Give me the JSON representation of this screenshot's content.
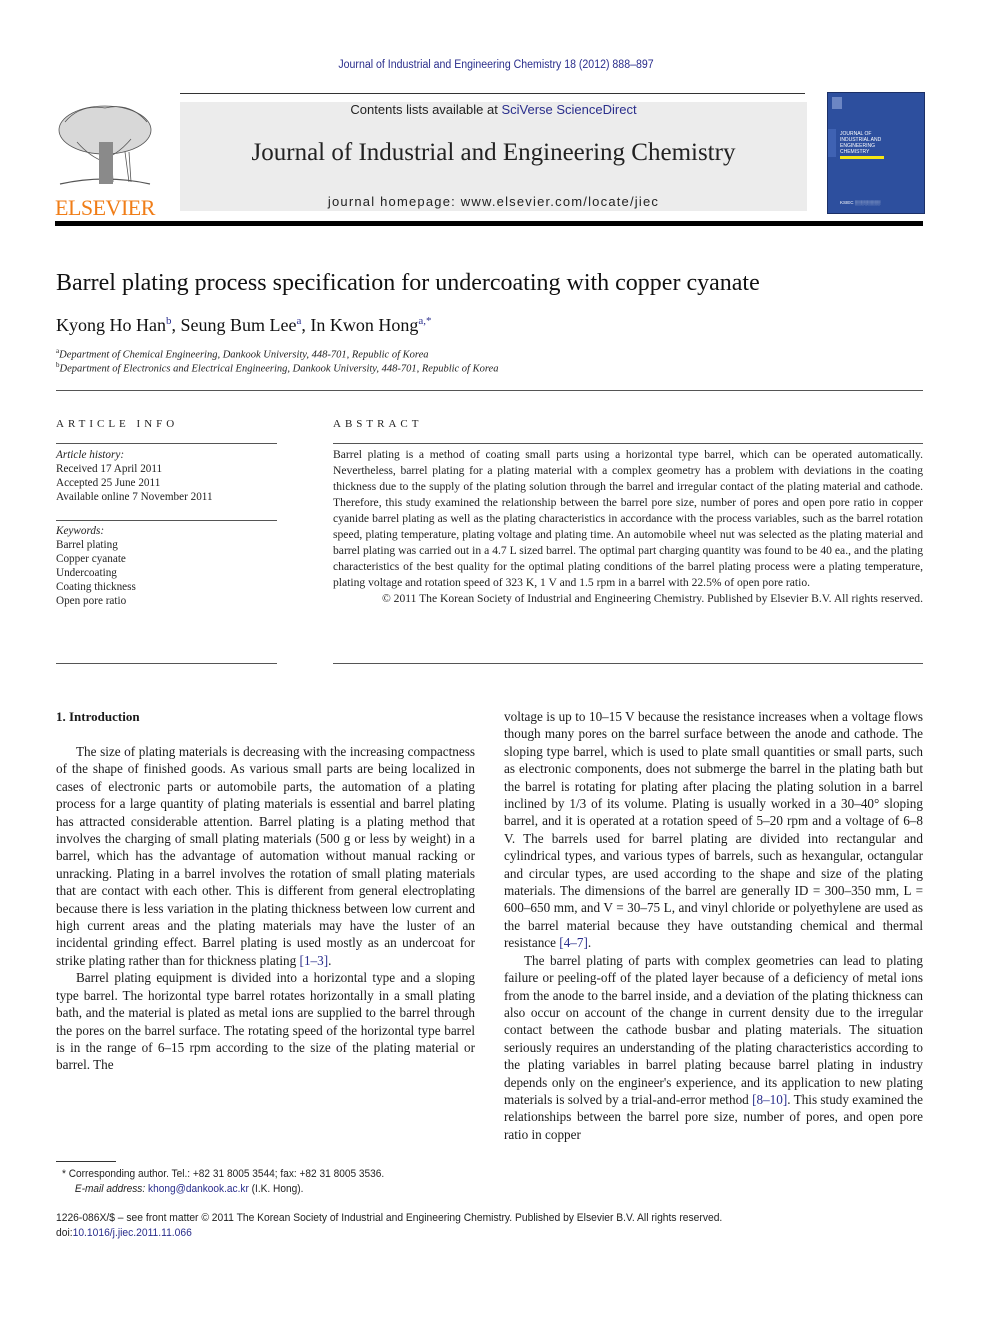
{
  "running_head": "Journal of Industrial and Engineering Chemistry 18 (2012) 888–897",
  "publisher": {
    "logo_wordmark": "ELSEVIER",
    "contents_prefix": "Contents lists available at ",
    "contents_link": "SciVerse ScienceDirect",
    "journal_title": "Journal of Industrial and Engineering Chemistry",
    "homepage": "journal homepage: www.elsevier.com/locate/jiec",
    "cover_title_lines": [
      "JOURNAL OF",
      "INDUSTRIAL AND",
      "ENGINEERING",
      "CHEMISTRY"
    ],
    "colors": {
      "link": "#2a2e8c",
      "elsevier_orange": "#f07d17",
      "cover_blue": "#2d4f9e",
      "cover_accent": "#f5e614"
    }
  },
  "article": {
    "title": "Barrel plating process specification for undercoating with copper cyanate",
    "authors": [
      {
        "name": "Kyong Ho Han",
        "sup": "b"
      },
      {
        "name": "Seung Bum Lee",
        "sup": "a"
      },
      {
        "name": "In Kwon Hong",
        "sup": "a,*"
      }
    ],
    "affiliations": [
      {
        "sup": "a",
        "text": "Department of Chemical Engineering, Dankook University, 448-701, Republic of Korea"
      },
      {
        "sup": "b",
        "text": "Department of Electronics and Electrical Engineering, Dankook University, 448-701, Republic of Korea"
      }
    ]
  },
  "article_info": {
    "heading": "ARTICLE INFO",
    "history_label": "Article history:",
    "history": [
      "Received 17 April 2011",
      "Accepted 25 June 2011",
      "Available online 7 November 2011"
    ],
    "keywords_label": "Keywords:",
    "keywords": [
      "Barrel plating",
      "Copper cyanate",
      "Undercoating",
      "Coating thickness",
      "Open pore ratio"
    ]
  },
  "abstract": {
    "heading": "ABSTRACT",
    "text": "Barrel plating is a method of coating small parts using a horizontal type barrel, which can be operated automatically. Nevertheless, barrel plating for a plating material with a complex geometry has a problem with deviations in the coating thickness due to the supply of the plating solution through the barrel and irregular contact of the plating material and cathode. Therefore, this study examined the relationship between the barrel pore size, number of pores and open pore ratio in copper cyanide barrel plating as well as the plating characteristics in accordance with the process variables, such as the barrel rotation speed, plating temperature, plating voltage and plating time. An automobile wheel nut was selected as the plating material and barrel plating was carried out in a 4.7 L sized barrel. The optimal part charging quantity was found to be 40 ea., and the plating characteristics of the best quality for the optimal plating conditions of the barrel plating process were a plating temperature, plating voltage and rotation speed of 323 K, 1 V and 1.5 rpm in a barrel with 22.5% of open pore ratio.",
    "copyright": "© 2011 The Korean Society of Industrial and Engineering Chemistry. Published by Elsevier B.V. All rights reserved."
  },
  "body": {
    "section_heading": "1.  Introduction",
    "left_col": {
      "p1_before_ref": "The size of plating materials is decreasing with the increasing compactness of the shape of finished goods. As various small parts are being localized in cases of electronic parts or automobile parts, the automation of a plating process for a large quantity of plating materials is essential and barrel plating has attracted considerable attention. Barrel plating is a plating method that involves the charging of small plating materials (500 g or less by weight) in a barrel, which has the advantage of automation without manual racking or unracking. Plating in a barrel involves the rotation of small plating materials that are contact with each other. This is different from general electroplating because there is less variation in the plating thickness between low current and high current areas and the plating materials may have the luster of an incidental grinding effect. Barrel plating is used mostly as an undercoat for strike plating rather than for thickness plating ",
      "p1_ref": "[1–3]",
      "p1_after_ref": ".",
      "p2": "Barrel plating equipment is divided into a horizontal type and a sloping type barrel. The horizontal type barrel rotates horizontally in a small plating bath, and the material is plated as metal ions are supplied to the barrel through the pores on the barrel surface. The rotating speed of the horizontal type barrel is in the range of 6–15 rpm according to the size of the plating material or barrel. The"
    },
    "right_col": {
      "p1_before_ref": "voltage is up to 10–15 V because the resistance increases when a voltage flows though many pores on the barrel surface between the anode and cathode. The sloping type barrel, which is used to plate small quantities or small parts, such as electronic components, does not submerge the barrel in the plating bath but the barrel is rotating for plating after placing the plating solution in a barrel inclined by 1/3 of its volume. Plating is usually worked in a 30–40° sloping barrel, and it is operated at a rotation speed of 5–20 rpm and a voltage of 6–8 V. The barrels used for barrel plating are divided into rectangular and cylindrical types, and various types of barrels, such as hexangular, octangular and circular types, are used according to the shape and size of the plating materials. The dimensions of the barrel are generally ID = 300–350 mm, L = 600–650 mm, and V = 30–75 L, and vinyl chloride or polyethylene are used as the barrel material because they have outstanding chemical and thermal resistance ",
      "p1_ref": "[4–7]",
      "p1_after_ref": ".",
      "p2_before_ref": "The barrel plating of parts with complex geometries can lead to plating failure or peeling-off of the plated layer because of a deficiency of metal ions from the anode to the barrel inside, and a deviation of the plating thickness can also occur on account of the change in current density due to the irregular contact between the cathode busbar and plating materials. The situation seriously requires an understanding of the plating characteristics according to the plating variables in barrel plating because barrel plating in industry depends only on the engineer's experience, and its application to new plating materials is solved by a trial-and-error method ",
      "p2_ref": "[8–10]",
      "p2_after_ref": ". This study examined the relationships between the barrel pore size, number of pores, and open pore ratio in copper"
    }
  },
  "footnote": {
    "line1": "* Corresponding author. Tel.: +82 31 8005 3544; fax: +82 31 8005 3536.",
    "email_label": "E-mail address: ",
    "email": "khong@dankook.ac.kr",
    "email_suffix": " (I.K. Hong)."
  },
  "bottom": {
    "front_matter": "1226-086X/$ – see front matter © 2011 The Korean Society of Industrial and Engineering Chemistry. Published by Elsevier B.V. All rights reserved.",
    "doi_prefix": "doi:",
    "doi": "10.1016/j.jiec.2011.11.066"
  }
}
